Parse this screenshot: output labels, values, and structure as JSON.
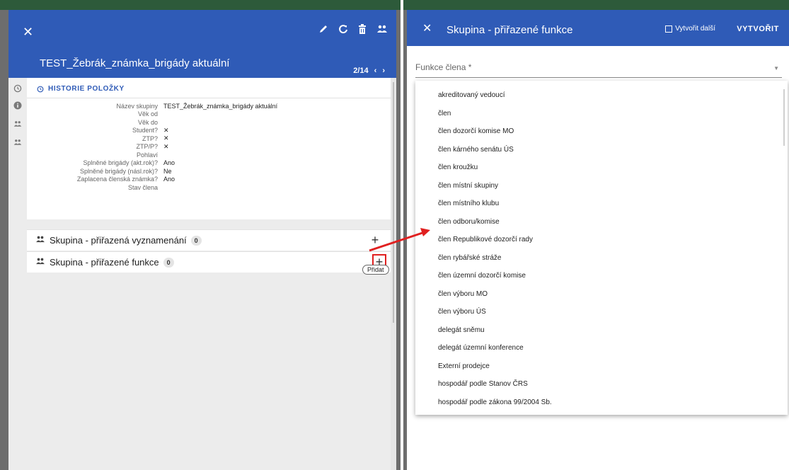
{
  "left": {
    "title": "TEST_Žebrák_známka_brigády aktuální",
    "pager": "2/14",
    "history_label": "HISTORIE POLOŽKY",
    "fields": [
      {
        "key": "Název skupiny",
        "value": "TEST_Žebrák_známka_brigády aktuální"
      },
      {
        "key": "Věk od",
        "value": ""
      },
      {
        "key": "Věk do",
        "value": ""
      },
      {
        "key": "Student?",
        "value": "✕"
      },
      {
        "key": "ZTP?",
        "value": "✕"
      },
      {
        "key": "ZTP/P?",
        "value": "✕"
      },
      {
        "key": "Pohlaví",
        "value": ""
      },
      {
        "key": "Splněné brigády (akt.rok)?",
        "value": "Ano"
      },
      {
        "key": "Splněné brigády (násl.rok)?",
        "value": "Ne"
      },
      {
        "key": "Zaplacena členská známka?",
        "value": "Ano"
      },
      {
        "key": "Stav člena",
        "value": ""
      }
    ],
    "sections": [
      {
        "title": "Skupina - přiřazená vyznamenání",
        "count": "0"
      },
      {
        "title": "Skupina - přiřazené funkce",
        "count": "0"
      }
    ],
    "tooltip": "Přidat"
  },
  "right": {
    "title": "Skupina - přiřazené funkce",
    "create_another": "Vytvořit další",
    "create_button": "VYTVOŘIT",
    "field_placeholder": "Funkce člena *",
    "options": [
      "akreditovaný vedoucí",
      "člen",
      "člen dozorčí komise MO",
      "člen kárného senátu ÚS",
      "člen kroužku",
      "člen místní skupiny",
      "člen místního klubu",
      "člen odboru/komise",
      "člen Republikové dozorčí rady",
      "člen rybářské stráže",
      "člen územní dozorčí komise",
      "člen výboru MO",
      "člen výboru ÚS",
      "delegát sněmu",
      "delegát územní konference",
      "Externí prodejce",
      "hospodář podle Stanov ČRS",
      "hospodář podle zákona 99/2004 Sb."
    ]
  },
  "colors": {
    "header_blue": "#2f5bb7",
    "highlight_red": "#e02020"
  },
  "icons": [
    "close-icon",
    "edit-icon",
    "refresh-icon",
    "delete-icon",
    "group-icon",
    "history-icon",
    "info-icon",
    "chevron-left-icon",
    "chevron-right-icon",
    "plus-icon",
    "dropdown-caret-icon",
    "checkbox-icon"
  ]
}
